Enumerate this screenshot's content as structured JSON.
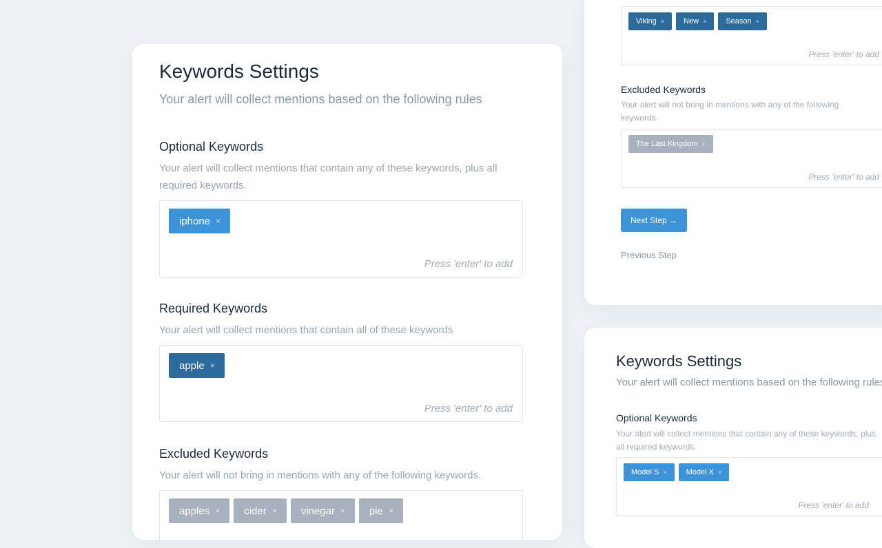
{
  "main": {
    "title": "Keywords Settings",
    "subtitle": "Your alert will collect mentions based on the following rules",
    "optional": {
      "heading": "Optional Keywords",
      "description": "Your alert will collect mentions that contain any of these keywords, plus all required keywords.",
      "tags": [
        "iphone"
      ],
      "hint": "Press 'enter' to add"
    },
    "required": {
      "heading": "Required Keywords",
      "description": "Your alert will collect mentions that contain all of these keywords",
      "tags": [
        "apple"
      ],
      "hint": "Press 'enter' to add"
    },
    "excluded": {
      "heading": "Excluded Keywords",
      "description": "Your alert will not bring in mentions with any of the following keywords.",
      "tags": [
        "apples",
        "cider",
        "vinegar",
        "pie"
      ]
    }
  },
  "top_right": {
    "required_tags": [
      "Viking",
      "New",
      "Season"
    ],
    "required_hint": "Press 'enter' to add",
    "excluded": {
      "heading": "Excluded Keywords",
      "description": "Your alert will not bring in mentions with any of the following keywords.",
      "tags": [
        "The Last Kingdom"
      ],
      "hint": "Press 'enter' to add"
    },
    "next_button": "Next Step →",
    "previous_link": "Previous Step"
  },
  "bottom_right": {
    "title": "Keywords Settings",
    "subtitle": "Your alert will collect mentions based on the following rules",
    "optional": {
      "heading": "Optional Keywords",
      "description": "Your alert will collect mentions that contain any of these keywords, plus all required keywords.",
      "tags": [
        "Model S",
        "Model X"
      ],
      "hint": "Press 'enter' to add"
    }
  },
  "tag_remove_symbol": "×",
  "colors": {
    "background": "#eef2f6",
    "optional_tag": "#3d92d8",
    "required_tag": "#2c6a9c",
    "excluded_tag": "#a8b1bd"
  }
}
